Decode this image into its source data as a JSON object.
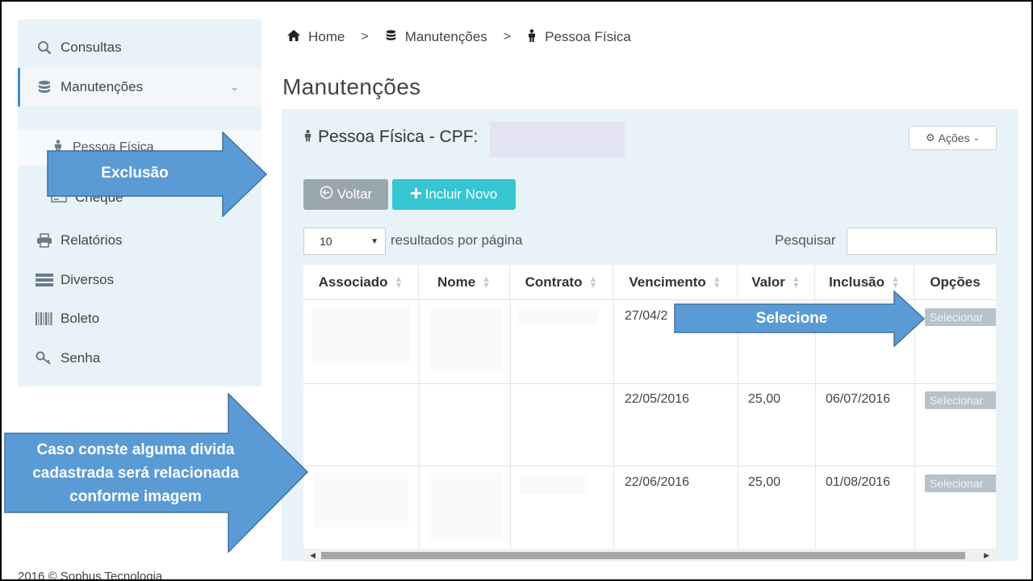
{
  "sidebar": {
    "items": [
      {
        "label": "Consultas",
        "icon": "search-icon"
      },
      {
        "label": "Manutenções",
        "icon": "database-icon"
      },
      {
        "label": "Cheque",
        "icon": "cheque-icon"
      },
      {
        "label": "Relatórios",
        "icon": "printer-icon"
      },
      {
        "label": "Diversos",
        "icon": "server-icon"
      },
      {
        "label": "Boleto",
        "icon": "barcode-icon"
      },
      {
        "label": "Senha",
        "icon": "key-icon"
      }
    ],
    "sub_item": {
      "label": "Pessoa Física",
      "icon": "person-icon"
    }
  },
  "breadcrumb": {
    "home": "Home",
    "manutencoes": "Manutenções",
    "pessoa": "Pessoa Física",
    "separator": ">"
  },
  "page": {
    "title": "Manutenções"
  },
  "panel": {
    "title": "Pessoa Física - CPF:",
    "actions_label": "Ações",
    "back_label": "Voltar",
    "new_label": "Incluir Novo"
  },
  "table_controls": {
    "page_length": "10",
    "length_label": "resultados por página",
    "search_label": "Pesquisar",
    "search_value": ""
  },
  "table": {
    "headers": [
      "Associado",
      "Nome",
      "Contrato",
      "Vencimento",
      "Valor",
      "Inclusão",
      "Opções"
    ],
    "rows": [
      {
        "vencimento": "27/04/2",
        "valor": "",
        "inclusao": "",
        "option": "Selecionar"
      },
      {
        "vencimento": "22/05/2016",
        "valor": "25,00",
        "inclusao": "06/07/2016",
        "option": "Selecionar"
      },
      {
        "vencimento": "22/06/2016",
        "valor": "25,00",
        "inclusao": "01/08/2016",
        "option": "Selecionar"
      }
    ]
  },
  "footer": {
    "text": "2016 © Sophus Tecnologia"
  },
  "callouts": {
    "exclusao": "Exclusão",
    "selecione": "Selecione",
    "divida_line1": "Caso conste alguma divida",
    "divida_line2": "cadastrada  será relacionada",
    "divida_line3": "conforme imagem"
  },
  "colors": {
    "callout": "#5b9bd5",
    "callout_border": "#41719c",
    "accent": "#3d8fd4",
    "btn_new": "#35c6d1",
    "btn_back": "#9aa6ad",
    "panel_bg": "#e8f2f9"
  }
}
